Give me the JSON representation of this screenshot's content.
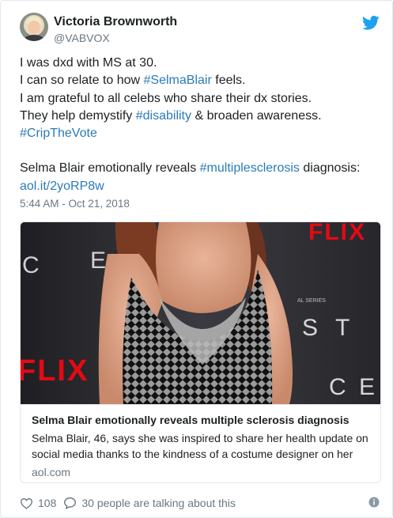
{
  "author": {
    "name": "Victoria Brownworth",
    "handle": "@VABVOX"
  },
  "tweet": {
    "line1": "I was dxd with MS at 30.",
    "line2_pre": "I can so relate to how ",
    "line2_tag": "#SelmaBlair",
    "line2_post": " feels.",
    "line3": "I am grateful to all celebs who share their dx stories.",
    "line4_pre": "They help demystify ",
    "line4_tag": "#disability",
    "line4_post": " & broaden awareness.",
    "line5_tag": "#CripTheVote",
    "line6_pre": "Selma Blair emotionally reveals ",
    "line6_tag": "#multiplesclerosis",
    "line6_post": " diagnosis:",
    "line7_link": "aol.it/2yoRP8w",
    "timestamp": "5:44 AM - Oct 21, 2018"
  },
  "card": {
    "image_text": {
      "netflix_right": "FLIX",
      "netflix_left": "FLIX",
      "backdrop_letters": [
        "C",
        "E",
        "S",
        "T",
        "C",
        "E"
      ],
      "small_text": "AL SERIES"
    },
    "title": "Selma Blair emotionally reveals multiple sclerosis diagnosis",
    "description": "Selma Blair, 46, says she was inspired to share her health update on social media thanks to the kindness of a costume designer on her",
    "domain": "aol.com"
  },
  "actions": {
    "likes": "108",
    "replies_text": "30 people are talking about this"
  },
  "colors": {
    "link": "#2b7bb9",
    "twitter_blue": "#1da1f2",
    "muted": "#697882",
    "netflix_red": "#e50914"
  }
}
